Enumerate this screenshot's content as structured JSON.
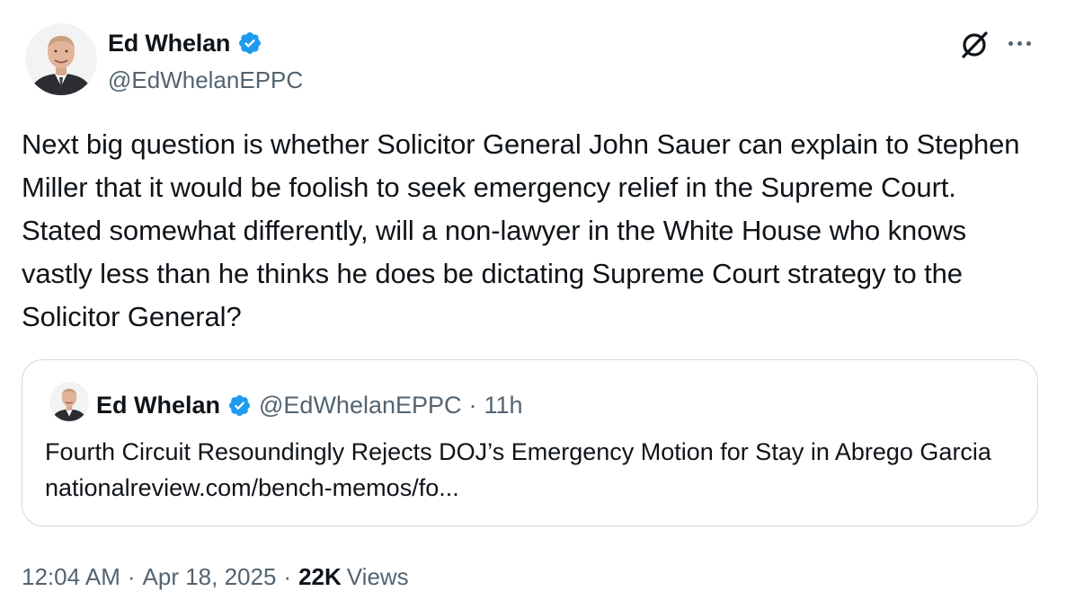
{
  "author": {
    "name": "Ed Whelan",
    "handle": "@EdWhelanEPPC",
    "verified": true
  },
  "icons": {
    "verified": "verified-badge-icon",
    "grok": "grok-icon",
    "more": "more-options-icon"
  },
  "colors": {
    "verified_blue": "#1d9bf0",
    "text_primary": "#0f1419",
    "text_secondary": "#536471",
    "border": "#cfd9de"
  },
  "tweet": {
    "text": "Next big question is whether Solicitor General John Sauer can explain to Stephen Miller that it would be foolish to seek emergency relief in the Supreme Court. Stated somewhat differently, will a non-lawyer in the White House who knows vastly less than he thinks he does be dictating Supreme Court strategy to the Solicitor General?"
  },
  "quote": {
    "name": "Ed Whelan",
    "handle": "@EdWhelanEPPC",
    "separator": "·",
    "time": "11h",
    "text": "Fourth Circuit Resoundingly Rejects DOJ’s Emergency Motion for Stay in Abrego Garcia nationalreview.com/bench-memos/fo..."
  },
  "footer": {
    "time": "12:04 AM",
    "sep1": "·",
    "date": "Apr 18, 2025",
    "sep2": "·",
    "views_count": "22K",
    "views_label": "Views"
  }
}
